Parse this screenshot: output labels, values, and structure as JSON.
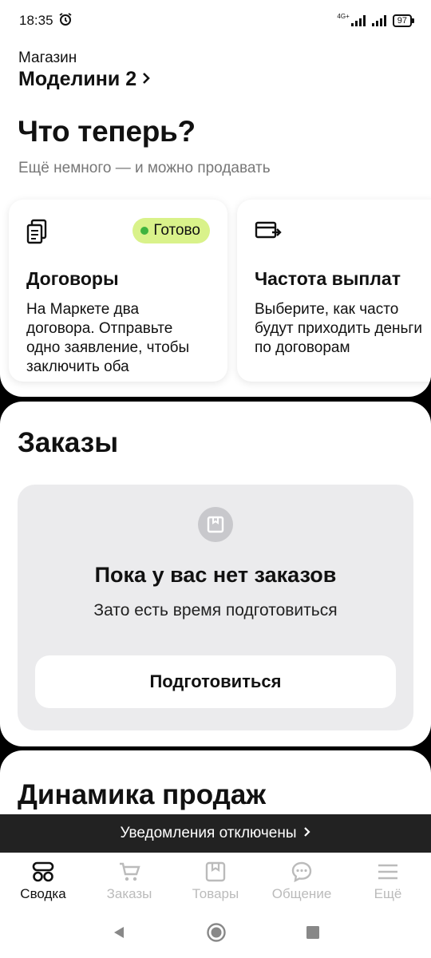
{
  "status_bar": {
    "time": "18:35",
    "network": "4G+",
    "battery": "97"
  },
  "header": {
    "shop_label": "Магазин",
    "shop_name": "Моделини 2",
    "title": "Что теперь?",
    "subtitle": "Ещё немного — и можно продавать"
  },
  "cards": [
    {
      "icon": "document-icon",
      "badge": "Готово",
      "title": "Договоры",
      "text": "На Маркете два договора. Отправьте одно заявление, чтобы заключить оба"
    },
    {
      "icon": "payout-card-icon",
      "title": "Частота выплат",
      "text": "Выберите, как часто будут приходить деньги по договорам"
    }
  ],
  "orders": {
    "title": "Заказы",
    "empty_title": "Пока у вас нет заказов",
    "empty_subtitle": "Зато есть время подготовиться",
    "button_label": "Подготовиться"
  },
  "dynamics": {
    "title": "Динамика продаж"
  },
  "notification": {
    "text": "Уведомления отключены"
  },
  "bottom_nav": [
    {
      "label": "Сводка",
      "icon": "summary-icon",
      "active": true
    },
    {
      "label": "Заказы",
      "icon": "cart-icon",
      "active": false
    },
    {
      "label": "Товары",
      "icon": "box-icon",
      "active": false
    },
    {
      "label": "Общение",
      "icon": "chat-icon",
      "active": false
    },
    {
      "label": "Ещё",
      "icon": "menu-icon",
      "active": false
    }
  ],
  "colors": {
    "badge_bg": "#d9f28a",
    "badge_dot": "#3fb33f",
    "empty_bg": "#ebebed",
    "notif_bg": "#222222"
  }
}
